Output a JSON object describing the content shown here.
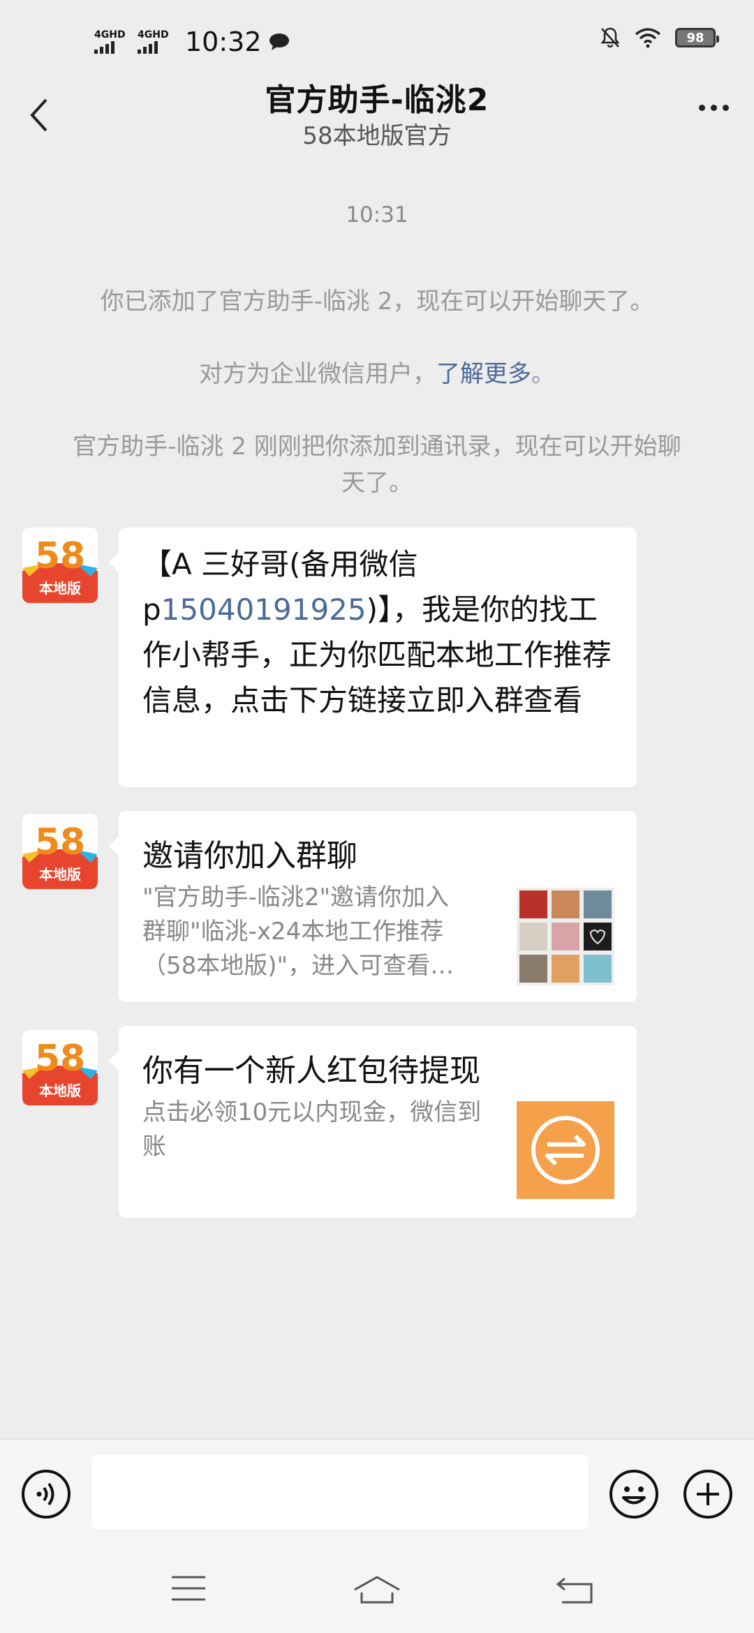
{
  "status_bar": {
    "network1": "4GHD",
    "network2": "4GHD",
    "time": "10:32",
    "battery": "98"
  },
  "header": {
    "title": "官方助手-临洮2",
    "subtitle": "58本地版官方"
  },
  "timestamp": "10:31",
  "system_messages": {
    "added": "你已添加了官方助手-临洮 2，现在可以开始聊天了。",
    "enterprise_prefix": "对方为企业微信用户，",
    "enterprise_link": "了解更多",
    "enterprise_suffix": "。",
    "contact_added": "官方助手-临洮 2 刚刚把你添加到通讯录，现在可以开始聊天了。"
  },
  "avatar": {
    "number": "58",
    "label": "本地版"
  },
  "messages": [
    {
      "part1": "【A 三好哥(备用微信 p",
      "phone": "15040191925",
      "part2": ")】，我是你的找工作小帮手，正为你匹配本地工作推荐信息，点击下方链接立即入群查看"
    },
    {
      "title": "邀请你加入群聊",
      "description": "\"官方助手-临洮2\"邀请你加入群聊\"临洮-x24本地工作推荐（58本地版)\"，进入可查看…"
    },
    {
      "title": "你有一个新人红包待提现",
      "description": "点击必领10元以内现金，微信到账"
    }
  ],
  "colors": {
    "link": "#4a6a9a",
    "background": "#ededed",
    "card_orange": "#f5a04a"
  }
}
